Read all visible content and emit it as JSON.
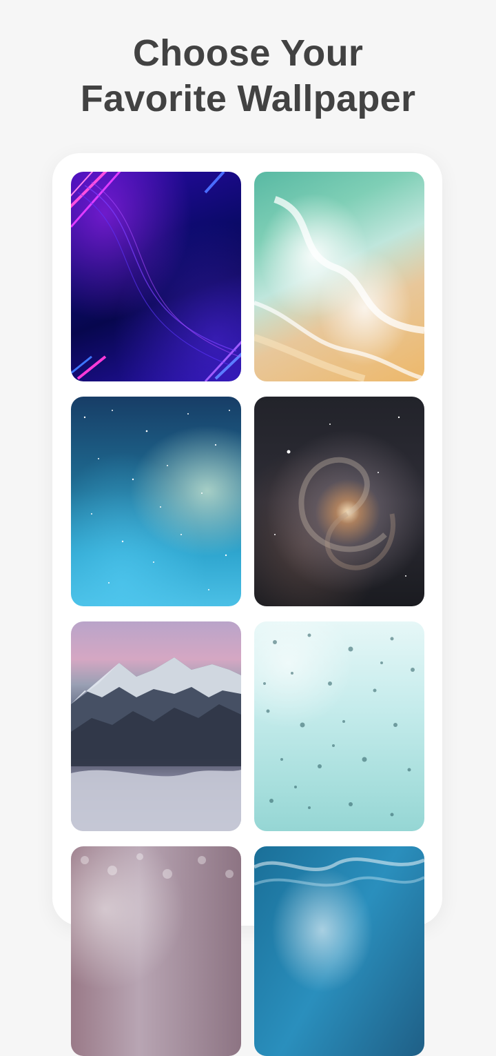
{
  "header": {
    "title_line1": "Choose Your",
    "title_line2": "Favorite Wallpaper"
  },
  "wallpapers": [
    {
      "name": "neon-lights",
      "icon": "neon-wallpaper"
    },
    {
      "name": "beach-waves",
      "icon": "beach-wallpaper"
    },
    {
      "name": "nebula-sky",
      "icon": "nebula-wallpaper"
    },
    {
      "name": "spiral-galaxy",
      "icon": "galaxy-wallpaper"
    },
    {
      "name": "snowy-mountains",
      "icon": "mountain-wallpaper"
    },
    {
      "name": "water-drops",
      "icon": "drops-wallpaper"
    },
    {
      "name": "pebbles",
      "icon": "pebbles-wallpaper"
    },
    {
      "name": "ocean-water",
      "icon": "ocean-wallpaper"
    }
  ],
  "colors": {
    "background": "#f6f6f6",
    "heading": "#424242",
    "frame": "#ffffff"
  }
}
